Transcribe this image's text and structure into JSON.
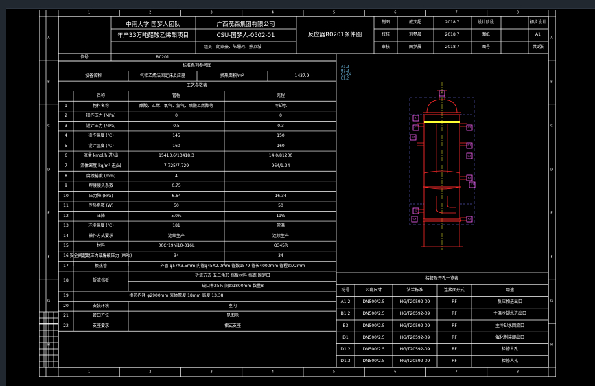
{
  "title_block": {
    "university": "中南大学 国梦人团队",
    "company": "广西茂森集团有限公司",
    "project": "年产33万吨醋酸乙烯酯项目",
    "drawing_no": "CSU-国梦人-0502-01",
    "drawing_title": "反应器R0201条件图",
    "team_line": "组员：朗家豪、陈姗珂、熊京城",
    "role_labels": [
      "制图",
      "校核",
      "审核"
    ],
    "names": [
      "戚文超",
      "刘梦晨",
      "国梦晨"
    ],
    "dates": [
      "2018.7",
      "2018.7",
      "2018.7"
    ],
    "right_labels": [
      "设计阶段",
      "图纸",
      "图号"
    ],
    "right_values": [
      "初步设计",
      "A1",
      "共1张"
    ],
    "position_label": "位号",
    "position_value": "R0201"
  },
  "border": {
    "col_numbers": [
      "1",
      "2",
      "3",
      "4",
      "5",
      "6",
      "7",
      "8"
    ],
    "row_letters": [
      "A",
      "B",
      "C",
      "D",
      "E",
      "F",
      "G",
      "H"
    ]
  },
  "process_table": {
    "header": "标准系列参考图",
    "equipment_label": "设备名称",
    "equipment_name": "气相乙烯法固定床反应器",
    "area_label": "换热面积/m²",
    "area_value": "1437.9",
    "params_header": "工艺参数表",
    "col_headers": [
      "名称",
      "管程",
      "壳程"
    ],
    "rows": [
      {
        "no": "1",
        "name": "物料名称",
        "tube": "醋酸、乙烯、氧气、氮气、醋酸乙烯酯等",
        "shell": "冷却水"
      },
      {
        "no": "2",
        "name": "操作压力 (MPa)",
        "tube": "0",
        "shell": "0"
      },
      {
        "no": "3",
        "name": "设计压力 (MPa)",
        "tube": "0.5",
        "shell": "0.3"
      },
      {
        "no": "4",
        "name": "操作温度 (℃)",
        "tube": "145",
        "shell": "150"
      },
      {
        "no": "5",
        "name": "设计温度 (℃)",
        "tube": "160",
        "shell": "160"
      },
      {
        "no": "6",
        "name": "流量 kmol/h 进/出",
        "tube": "15413.6/13418.3",
        "shell": "14.0/81200"
      },
      {
        "no": "7",
        "name": "流体密度 kg/m³ 进/出",
        "tube": "7.725/7.729",
        "shell": "964/1.24"
      },
      {
        "no": "8",
        "name": "腐蚀裕度 (mm)",
        "tube": "4",
        "shell": ""
      },
      {
        "no": "9",
        "name": "焊接接头系数",
        "tube": "0.75",
        "shell": ""
      },
      {
        "no": "10",
        "name": "压力降 (kPa)",
        "tube": "6.64",
        "shell": "16.34"
      },
      {
        "no": "11",
        "name": "传热系数 (W)",
        "tube": "50",
        "shell": "50"
      },
      {
        "no": "12",
        "name": "压降",
        "tube": "5.0%",
        "shell": "11%"
      },
      {
        "no": "13",
        "name": "环境温度 (℃)",
        "tube": "181",
        "shell": "常温"
      },
      {
        "no": "14",
        "name": "操作方式要求",
        "tube": "连续生产",
        "shell": "连续生产"
      },
      {
        "no": "15",
        "name": "材料",
        "tube": "00Cr19Ni10-316L",
        "shell": "Q345R"
      },
      {
        "no": "16",
        "name": "安全阀起跳压力或爆破压力 (MPa)",
        "tube": "34",
        "shell": "34"
      }
    ],
    "row17": {
      "no": "17",
      "name": "换热管",
      "value": "外管 φ57X3.5mm 内管φ45X2.0mm 管数1579 管长4000mm 管程距72mm"
    },
    "row18": {
      "no": "18",
      "name": "折流挡板",
      "line1": "折流方式  五二角形  挡板材料  挡距  固定口",
      "line2": "缺口率25%  间距1800mm  数量8"
    },
    "row19": {
      "no": "19",
      "value": "换热内径  φ2900mm  壳体厚度  18mm  高度  13.38"
    },
    "row20": {
      "no": "20",
      "name": "安装环境",
      "value": "室内"
    },
    "row21": {
      "no": "21",
      "name": "管口方位",
      "value": "见图示"
    },
    "row22": {
      "no": "22",
      "name": "支座要求",
      "value": "裙式支座"
    }
  },
  "nozzle_table": {
    "header": "接管及开孔一览表",
    "col_headers": [
      "符号",
      "公称尺寸",
      "法兰标准",
      "连接面形式",
      "用途"
    ],
    "rows": [
      {
        "sym": "A1,2",
        "size": "DN500/2.5",
        "std": "HG/T20592-09",
        "face": "RF",
        "use": "反应物进出口"
      },
      {
        "sym": "B1,2",
        "size": "DN500/2.5",
        "std": "HG/T20592-09",
        "face": "RF",
        "use": "主温冷却水进出口"
      },
      {
        "sym": "B3",
        "size": "DN500/2.5",
        "std": "HG/T20592-09",
        "face": "RF",
        "use": "主冷却水回流口"
      },
      {
        "sym": "D1",
        "size": "DN500/2.5",
        "std": "HG/T20592-09",
        "face": "RF",
        "use": "催化剂装卸出口"
      },
      {
        "sym": "D1,2",
        "size": "DN500/2.5",
        "std": "HG/T20592-09",
        "face": "RF",
        "use": "检修人孔"
      },
      {
        "sym": "D1,3",
        "size": "DN500/2.5",
        "std": "HG/T20592-09",
        "face": "RF",
        "use": "检修人孔"
      }
    ]
  },
  "legend": {
    "items": [
      "A1,2",
      "B1,2",
      "C1-C4",
      "E1,2"
    ]
  },
  "nozzle_labels": [
    "A1",
    "B1",
    "C1",
    "C2",
    "C3",
    "D1",
    "D2",
    "B2",
    "E1",
    "E2",
    "A2",
    "C4"
  ],
  "colors": {
    "frame": "#ffffff",
    "vessel": "#ff2a2a",
    "dashed": "#7b7bff",
    "nozzle_mark": "#ff66ff",
    "catalyst": "#ffff33",
    "axis": "#ffff33"
  }
}
